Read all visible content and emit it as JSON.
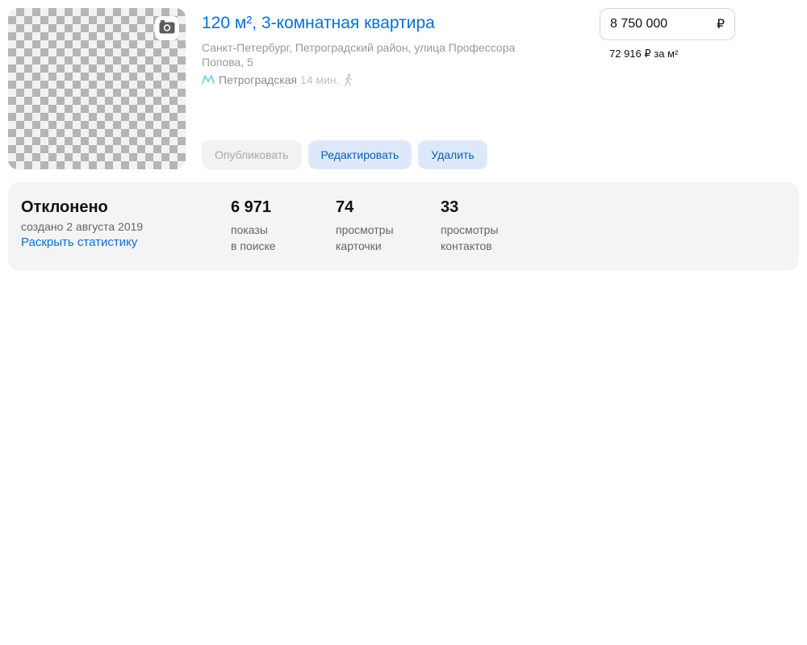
{
  "offer": {
    "title": "120 м², 3-комнатная квартира",
    "address": "Санкт-Петербург, Петроградский район, улица Профессора Попова, 5",
    "metro": {
      "station": "Петроградская",
      "time": "14 мин.",
      "line_color": "#7fd3ea"
    },
    "price": {
      "value": "8 750 000",
      "currency": "₽",
      "per_meter": "72 916 ₽ за м²"
    },
    "actions": {
      "publish_label": "Опубликовать",
      "edit_label": "Редактировать",
      "delete_label": "Удалить"
    },
    "icons": {
      "photo": "camera-icon",
      "metro": "metro-icon",
      "walk": "walking-icon"
    }
  },
  "stats": {
    "status": "Отклонено",
    "created": "создано 2 августа 2019",
    "expand_link": "Раскрыть статистику",
    "metrics": [
      {
        "value": "6 971",
        "label_line1": "показы",
        "label_line2": "в поиске"
      },
      {
        "value": "74",
        "label_line1": "просмотры",
        "label_line2": "карточки"
      },
      {
        "value": "33",
        "label_line1": "просмотры",
        "label_line2": "контактов"
      }
    ]
  },
  "colors": {
    "link": "#0a6fd4",
    "button_bg": "#dde9f8",
    "button_text": "#0b5fb3",
    "panel_bg": "#f4f4f4"
  }
}
